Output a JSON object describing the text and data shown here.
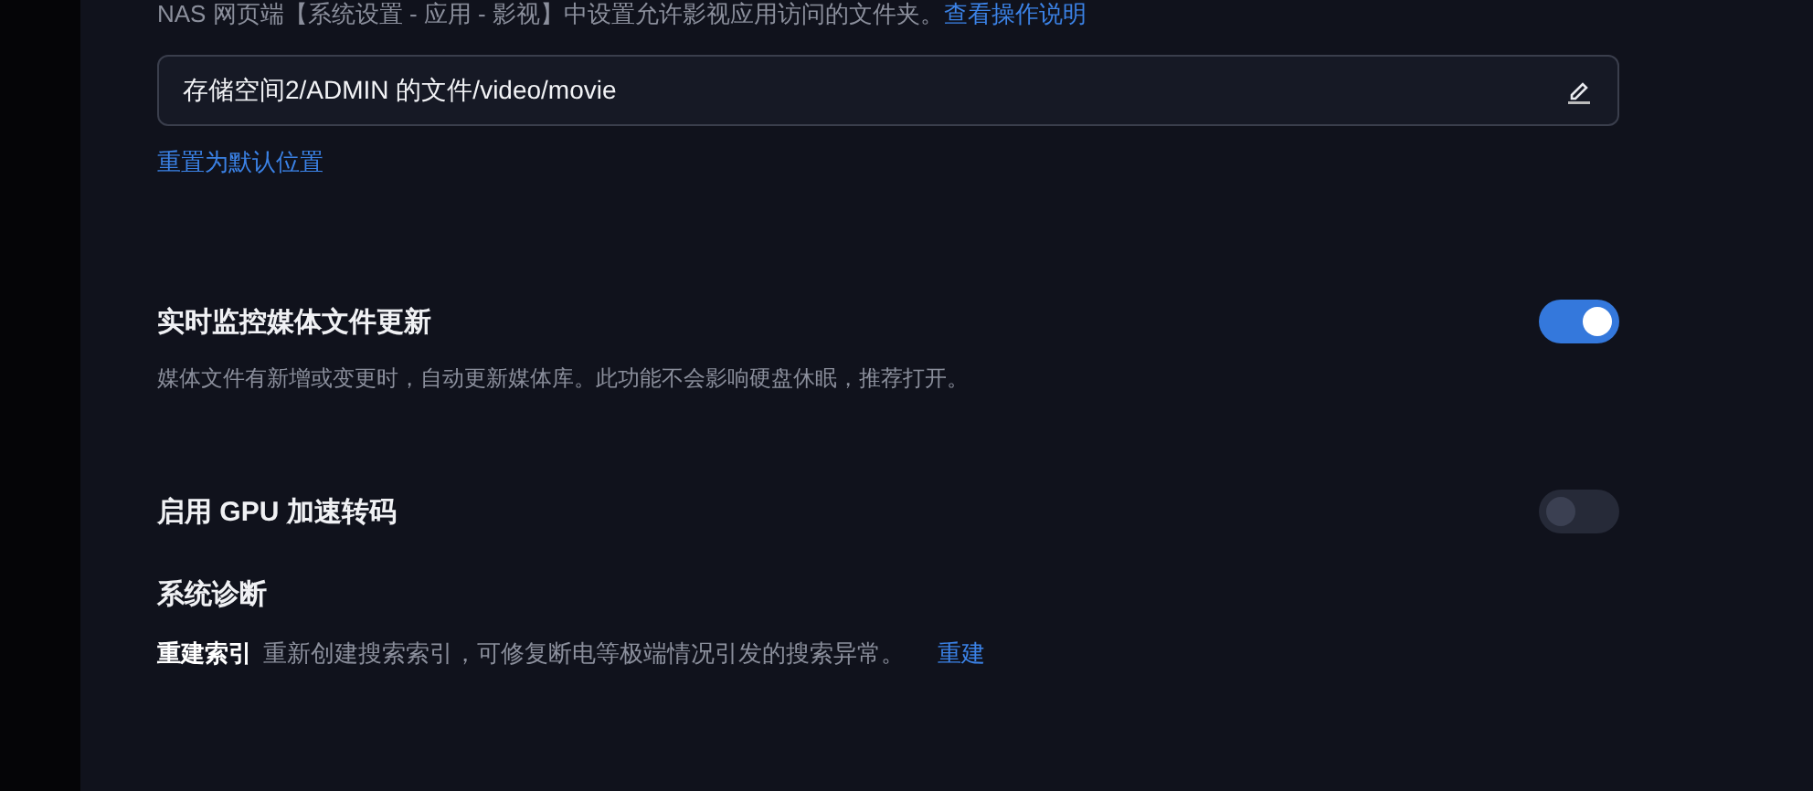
{
  "folder_section": {
    "hint": "NAS 网页端【系统设置 - 应用 - 影视】中设置允许影视应用访问的文件夹。",
    "hint_link": "查看操作说明",
    "path": {
      "value": "存储空间2/ADMIN 的文件/video/movie"
    },
    "reset_link": "重置为默认位置"
  },
  "toggles": [
    {
      "title": "实时监控媒体文件更新",
      "description": "媒体文件有新增或变更时，自动更新媒体库。此功能不会影响硬盘休眠，推荐打开。",
      "on": true
    },
    {
      "title": "启用 GPU 加速转码",
      "on": false
    }
  ],
  "diagnostics": {
    "title": "系统诊断",
    "label": "重建索引",
    "description": "重新创建搜索索引，可修复断电等极端情况引发的搜索异常。",
    "action": "重建"
  }
}
